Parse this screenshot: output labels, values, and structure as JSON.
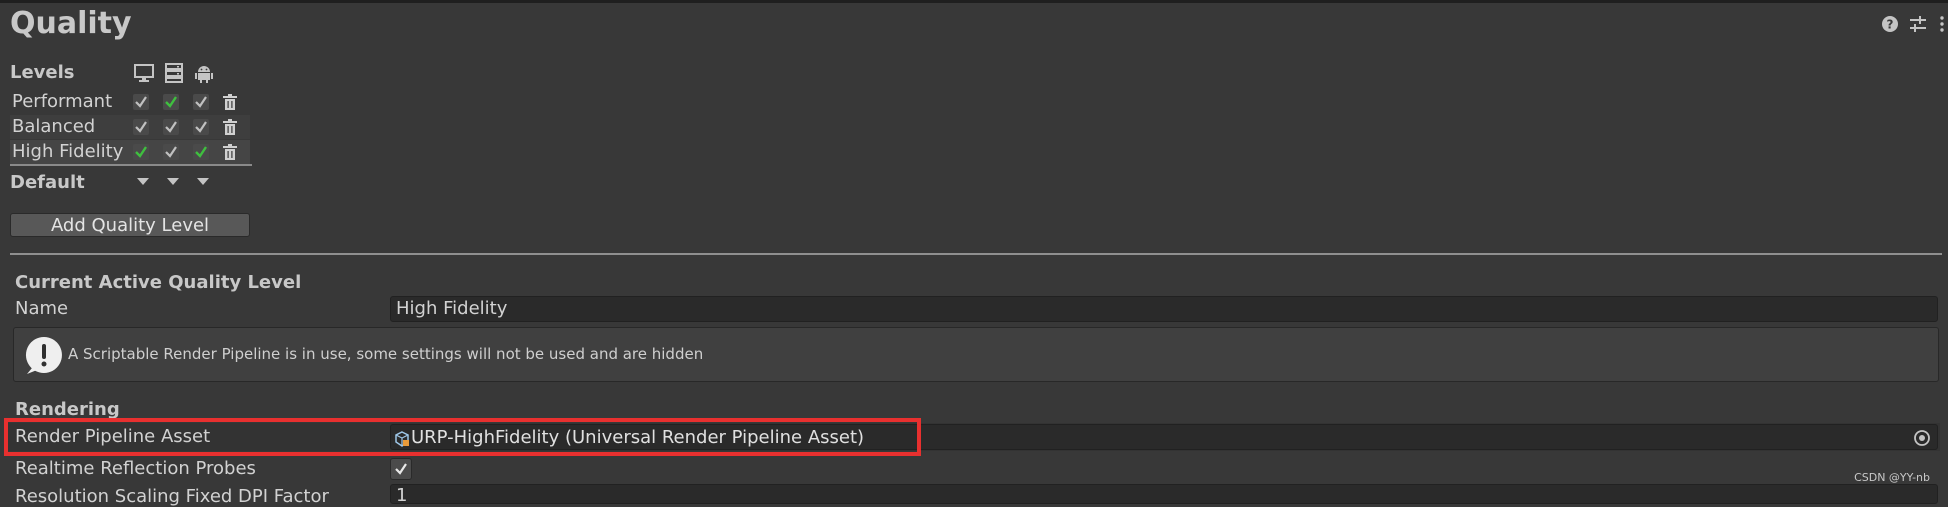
{
  "page": {
    "title": "Quality"
  },
  "header_icons": [
    "help-icon",
    "sliders-icon",
    "more-icon"
  ],
  "levels": {
    "label": "Levels",
    "platform_icons": [
      "desktop-icon",
      "server-icon",
      "android-icon"
    ],
    "items": [
      {
        "name": "Performant",
        "checks": [
          "gray",
          "green",
          "gray"
        ]
      },
      {
        "name": "Balanced",
        "checks": [
          "gray",
          "gray",
          "gray"
        ]
      },
      {
        "name": "High Fidelity",
        "checks": [
          "green",
          "gray",
          "green"
        ]
      }
    ],
    "default_label": "Default",
    "add_button": "Add Quality Level"
  },
  "current": {
    "section_title": "Current Active Quality Level",
    "name_label": "Name",
    "name_value": "High Fidelity",
    "help_text": "A Scriptable Render Pipeline is in use, some settings will not be used and are hidden"
  },
  "rendering": {
    "section_title": "Rendering",
    "rpa_label": "Render Pipeline Asset",
    "rpa_value": "URP-HighFidelity (Universal Render Pipeline Asset)",
    "probes_label": "Realtime Reflection Probes",
    "probes_checked": true,
    "next_label": "Resolution Scaling Fixed DPI Factor",
    "next_value": "1"
  },
  "watermark": "CSDN @YY-nb",
  "colors": {
    "background": "#383838",
    "check_green": "#3fbf3f",
    "check_gray": "#c0c0c0",
    "highlight_red": "#e8302f"
  }
}
